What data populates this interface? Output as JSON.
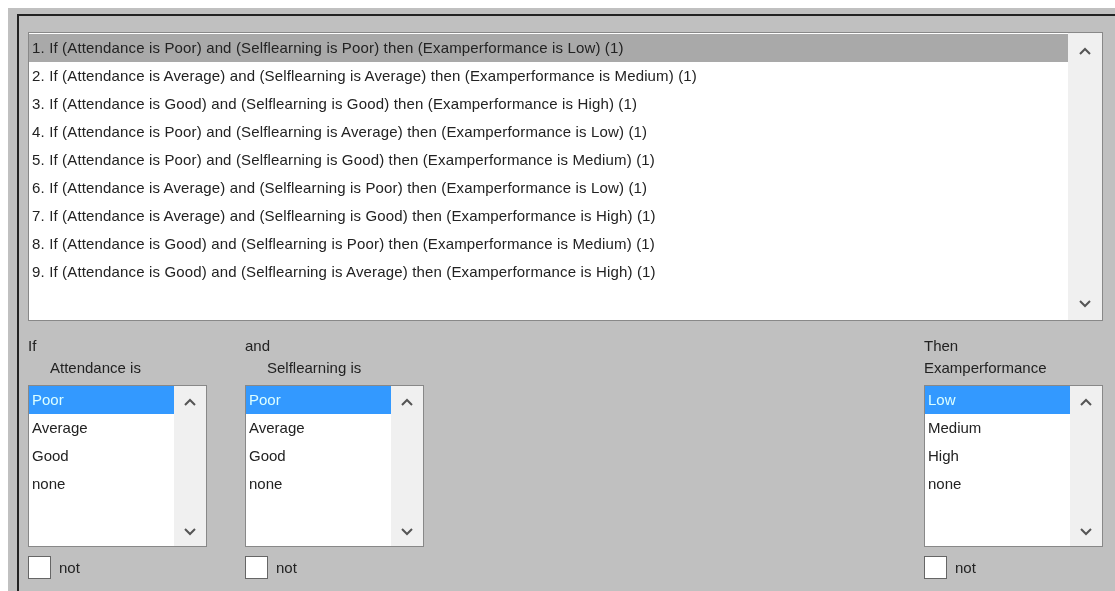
{
  "rules": [
    {
      "text": "1. If (Attendance is Poor) and (Selflearning is Poor) then (Examperformance is Low) (1)",
      "selected": true
    },
    {
      "text": "2. If (Attendance is Average) and (Selflearning is Average) then (Examperformance is Medium) (1)",
      "selected": false
    },
    {
      "text": "3. If (Attendance is Good) and (Selflearning is Good) then (Examperformance is High) (1)",
      "selected": false
    },
    {
      "text": "4. If (Attendance is Poor) and (Selflearning is Average) then (Examperformance is Low) (1)",
      "selected": false
    },
    {
      "text": "5. If (Attendance is Poor) and (Selflearning is Good) then (Examperformance is Medium) (1)",
      "selected": false
    },
    {
      "text": "6. If (Attendance is Average) and (Selflearning is Poor) then (Examperformance is Low) (1)",
      "selected": false
    },
    {
      "text": "7. If (Attendance is Average) and (Selflearning is Good) then (Examperformance is High) (1)",
      "selected": false
    },
    {
      "text": "8. If (Attendance is Good) and (Selflearning is Poor) then (Examperformance is Medium) (1)",
      "selected": false
    },
    {
      "text": "9. If (Attendance is Good) and (Selflearning is Average) then (Examperformance is High) (1)",
      "selected": false
    }
  ],
  "columns": [
    {
      "kind": "input",
      "connective": "If",
      "variable": "Attendance is",
      "options": [
        {
          "label": "Poor",
          "selected": true
        },
        {
          "label": "Average",
          "selected": false
        },
        {
          "label": "Good",
          "selected": false
        },
        {
          "label": "none",
          "selected": false
        }
      ],
      "negate": {
        "label": "not",
        "checked": false
      }
    },
    {
      "kind": "input",
      "connective": "and",
      "variable": "Selflearning is",
      "options": [
        {
          "label": "Poor",
          "selected": true
        },
        {
          "label": "Average",
          "selected": false
        },
        {
          "label": "Good",
          "selected": false
        },
        {
          "label": "none",
          "selected": false
        }
      ],
      "negate": {
        "label": "not",
        "checked": false
      }
    },
    {
      "kind": "output",
      "connective": "Then",
      "variable": "Examperformance",
      "options": [
        {
          "label": "Low",
          "selected": true
        },
        {
          "label": "Medium",
          "selected": false
        },
        {
          "label": "High",
          "selected": false
        },
        {
          "label": "none",
          "selected": false
        }
      ],
      "negate": {
        "label": "not",
        "checked": false
      }
    }
  ]
}
